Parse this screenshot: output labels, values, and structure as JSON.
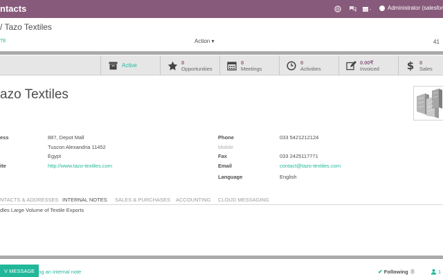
{
  "navbar": {
    "title": "ntacts",
    "user": "Administrator (salesfor",
    "icons": [
      "support-icon",
      "chat-icon",
      "gift-icon"
    ]
  },
  "control_panel": {
    "breadcrumb": "/ Tazo Textiles",
    "create_label": "TE",
    "action_label": "Action ▾",
    "pager": "41"
  },
  "smart_buttons": {
    "active": {
      "label": "Active"
    },
    "opportunities": {
      "value": "0",
      "label": "Opportunities"
    },
    "meetings": {
      "value": "0",
      "label": "Meetings"
    },
    "activities": {
      "value": "0",
      "label": "Activities"
    },
    "invoiced": {
      "value": "0.00₹",
      "label": "Invoiced"
    },
    "sales": {
      "value": "0",
      "label": "Sales"
    }
  },
  "partner": {
    "name": "azo Textiles",
    "address_label": "ess",
    "street": "887, Depot Mall",
    "city_line": "Tuscon  Alexandria  11452",
    "country": "Egypt",
    "website_label": "ite",
    "website": "http://www.tazo-textiles.com",
    "phone_label": "Phone",
    "phone": "033 5421212124",
    "mobile_label": "Mobile",
    "fax_label": "Fax",
    "fax": "033 2425117771",
    "email_label": "Email",
    "email": "contact@tazo-textiles.com",
    "language_label": "Language",
    "language": "English"
  },
  "tabs": [
    {
      "label": "NTACTS & ADDRESSES"
    },
    {
      "label": "INTERNAL NOTES"
    },
    {
      "label": "SALES & PURCHASES"
    },
    {
      "label": "ACCOUNTING"
    },
    {
      "label": "CLOUD MESSAGING"
    }
  ],
  "tab_content": {
    "internal_notes": "dles Large Volume of Textile Exports"
  },
  "chatter": {
    "new_message": "V MESSAGE",
    "log_note": "Log an internal note",
    "following": "Following",
    "followers_count": "1"
  },
  "colors": {
    "navbar": "#875a7b",
    "accent": "#21b799",
    "separator": "#a9a9a9"
  }
}
